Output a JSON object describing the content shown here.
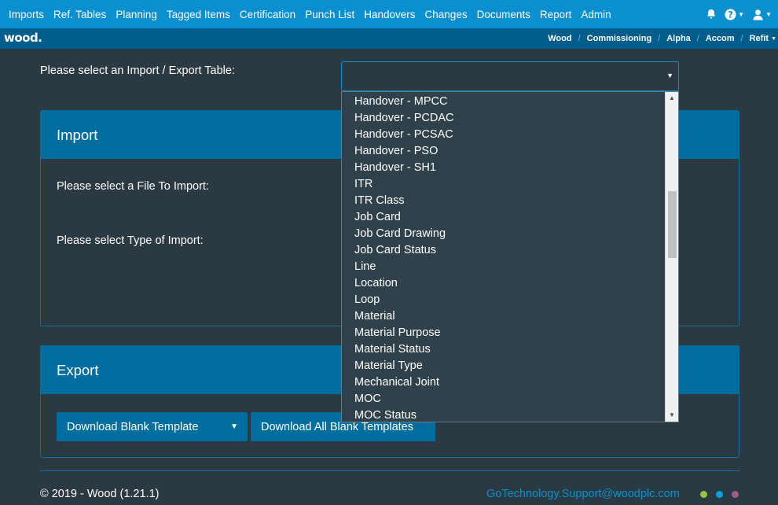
{
  "nav": {
    "items": [
      "Imports",
      "Ref. Tables",
      "Planning",
      "Tagged Items",
      "Certification",
      "Punch List",
      "Handovers",
      "Changes",
      "Documents",
      "Report",
      "Admin"
    ],
    "icons": [
      "bell-icon",
      "help-icon",
      "user-icon"
    ]
  },
  "brand": {
    "logo": "wood."
  },
  "breadcrumb": [
    "Wood",
    "Commissioning",
    "Alpha",
    "Accom",
    "Refit"
  ],
  "main": {
    "select_label": "Please select an Import / Export Table:",
    "select_value": ""
  },
  "import_panel": {
    "title": "Import",
    "file_label": "Please select a File To Import:",
    "type_label": "Please select Type of Import:"
  },
  "export_panel": {
    "title": "Export",
    "download_blank": "Download Blank Template",
    "download_all": "Download All Blank Templates"
  },
  "dropdown": {
    "options": [
      "Handover - MPCC",
      "Handover - PCDAC",
      "Handover - PCSAC",
      "Handover - PSO",
      "Handover - SH1",
      "ITR",
      "ITR Class",
      "Job Card",
      "Job Card Drawing",
      "Job Card Status",
      "Line",
      "Location",
      "Loop",
      "Material",
      "Material Purpose",
      "Material Status",
      "Material Type",
      "Mechanical Joint",
      "MOC",
      "MOC Status"
    ]
  },
  "footer": {
    "copyright": "© 2019 - Wood (1.21.1)",
    "support_email": "GoTechnology.Support@woodplc.com",
    "dot_colors": [
      "#8dc63f",
      "#00a3e0",
      "#a05a8c"
    ]
  },
  "colors": {
    "primary": "#0a8fd0",
    "subbar": "#005e8d",
    "panel_header": "#006d9f",
    "background": "#2b3a42"
  }
}
